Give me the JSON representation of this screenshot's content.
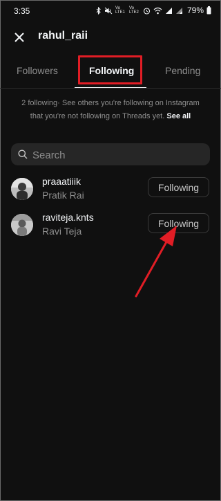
{
  "status_bar": {
    "time": "3:35",
    "battery": "79%",
    "lte1": "Vo LTE1",
    "lte2": "Vo LTE2"
  },
  "header": {
    "title": "rahul_raii"
  },
  "tabs": [
    {
      "label": "Followers",
      "active": false
    },
    {
      "label": "Following",
      "active": true
    },
    {
      "label": "Pending",
      "active": false
    }
  ],
  "info": {
    "text": "2 following· See others you're following on Instagram that you're not following on Threads yet.",
    "link": "See all"
  },
  "search": {
    "placeholder": "Search"
  },
  "users": [
    {
      "username": "praaatiiik",
      "full_name": "Pratik Rai",
      "button": "Following"
    },
    {
      "username": "raviteja.knts",
      "full_name": "Ravi Teja",
      "button": "Following"
    }
  ],
  "colors": {
    "background": "#101010",
    "highlight": "#e11d25",
    "muted": "#8e8e8e"
  }
}
